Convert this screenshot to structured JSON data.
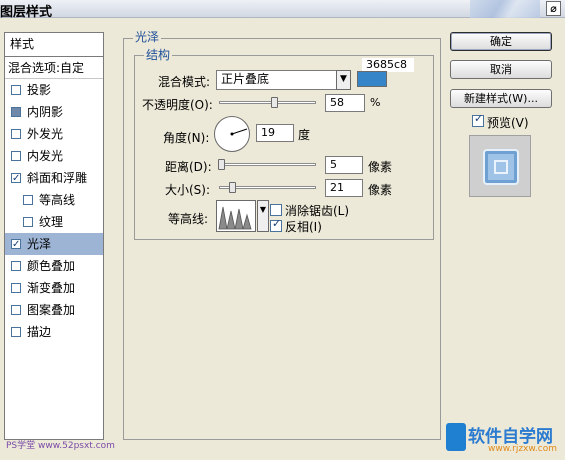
{
  "window": {
    "title": "图层样式",
    "close_label": "⌀"
  },
  "sidebar": {
    "header": "样式",
    "blend_label": "混合选项:自定",
    "items": [
      {
        "label": "投影",
        "checked": false,
        "sub": false,
        "active": false
      },
      {
        "label": "内阴影",
        "checked": false,
        "sub": false,
        "active": false,
        "filled": true
      },
      {
        "label": "外发光",
        "checked": false,
        "sub": false,
        "active": false
      },
      {
        "label": "内发光",
        "checked": false,
        "sub": false,
        "active": false
      },
      {
        "label": "斜面和浮雕",
        "checked": true,
        "sub": false,
        "active": false
      },
      {
        "label": "等高线",
        "checked": false,
        "sub": true,
        "active": false
      },
      {
        "label": "纹理",
        "checked": false,
        "sub": true,
        "active": false
      },
      {
        "label": "光泽",
        "checked": true,
        "sub": false,
        "active": true
      },
      {
        "label": "颜色叠加",
        "checked": false,
        "sub": false,
        "active": false
      },
      {
        "label": "渐变叠加",
        "checked": false,
        "sub": false,
        "active": false
      },
      {
        "label": "图案叠加",
        "checked": false,
        "sub": false,
        "active": false
      },
      {
        "label": "描边",
        "checked": false,
        "sub": false,
        "active": false
      }
    ]
  },
  "satin": {
    "section_title": "光泽",
    "structure_title": "结构",
    "color_hex_label": "3685c8",
    "color": "#3685c8",
    "blend_mode_label": "混合模式:",
    "blend_mode_value": "正片叠底",
    "opacity_label": "不透明度(O):",
    "opacity_value": "58",
    "opacity_unit": "%",
    "angle_label": "角度(N):",
    "angle_value": "19",
    "angle_unit": "度",
    "distance_label": "距离(D):",
    "distance_value": "5",
    "distance_unit": "像素",
    "size_label": "大小(S):",
    "size_value": "21",
    "size_unit": "像素",
    "contour_label": "等高线:",
    "anti_alias_label": "消除锯齿(L)",
    "anti_alias_checked": false,
    "invert_label": "反相(I)",
    "invert_checked": true
  },
  "buttons": {
    "ok": "确定",
    "cancel": "取消",
    "new_style": "新建样式(W)...",
    "preview_label": "预览(V)",
    "preview_checked": true
  },
  "watermarks": {
    "left": "PS学堂 www.52psxt.com",
    "right_title": "软件自学网",
    "right_url": "www.rjzxw.com"
  }
}
